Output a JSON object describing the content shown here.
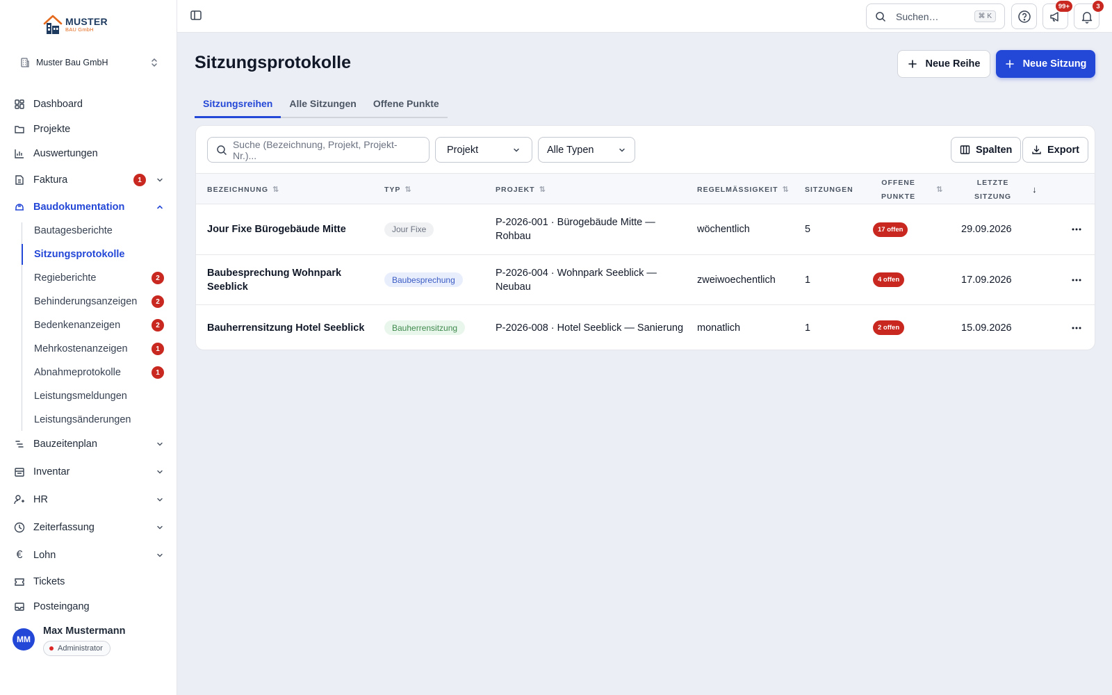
{
  "brand": {
    "title": "MUSTER",
    "subtitle": "BAU GmbH"
  },
  "org": {
    "name": "Muster Bau GmbH"
  },
  "nav": {
    "dashboard": "Dashboard",
    "projekte": "Projekte",
    "auswertungen": "Auswertungen",
    "faktura": {
      "label": "Faktura",
      "badge": "1"
    },
    "baudokumentation": "Baudokumentation",
    "sub": {
      "bautagesberichte": "Bautagesberichte",
      "sitzungsprotokolle": "Sitzungsprotokolle",
      "regieberichte": {
        "label": "Regieberichte",
        "badge": "2"
      },
      "behinderungsanzeigen": {
        "label": "Behinderungsanzeigen",
        "badge": "2"
      },
      "bedenkenanzeigen": {
        "label": "Bedenkenanzeigen",
        "badge": "2"
      },
      "mehrkostenanzeigen": {
        "label": "Mehrkostenanzeigen",
        "badge": "1"
      },
      "abnahmeprotokolle": {
        "label": "Abnahmeprotokolle",
        "badge": "1"
      },
      "leistungsmeldungen": "Leistungsmeldungen",
      "leistungsaenderungen": "Leistungsänderungen"
    },
    "bauzeitenplan": "Bauzeitenplan",
    "inventar": "Inventar",
    "hr": "HR",
    "zeiterfassung": "Zeiterfassung",
    "lohn": "Lohn",
    "tickets": "Tickets",
    "posteingang": "Posteingang"
  },
  "user": {
    "initials": "MM",
    "name": "Max Mustermann",
    "role": "Administrator"
  },
  "topbar": {
    "search_placeholder": "Suchen…",
    "shortcut": "⌘ K",
    "announcements_badge": "99+",
    "notifications_badge": "3"
  },
  "page": {
    "title": "Sitzungsprotokolle",
    "new_series": "Neue Reihe",
    "new_session": "Neue Sitzung"
  },
  "tabs": [
    "Sitzungsreihen",
    "Alle Sitzungen",
    "Offene Punkte"
  ],
  "filters": {
    "search_placeholder": "Suche (Bezeichnung, Projekt, Projekt-Nr.)...",
    "project": "Projekt",
    "type": "Alle Typen",
    "columns": "Spalten",
    "export": "Export"
  },
  "table": {
    "headers": {
      "bezeichnung": "BEZEICHNUNG",
      "typ": "TYP",
      "projekt": "PROJEKT",
      "regel": "REGELMÄSSIGKEIT",
      "sitzungen": "SITZUNGEN",
      "offene_1": "OFFENE",
      "offene_2": "PUNKTE",
      "letzte_1": "LETZTE",
      "letzte_2": "SITZUNG"
    },
    "rows": [
      {
        "name": "Jour Fixe Bürogebäude Mitte",
        "type": "Jour Fixe",
        "project_1": "P-2026-001 · Bürogebäude Mitte —",
        "project_2": "Rohbau",
        "regularity": "wöchentlich",
        "sessions": "5",
        "open": "17 offen",
        "last": "29.09.2026"
      },
      {
        "name_1": "Baubesprechung Wohnpark",
        "name_2": "Seeblick",
        "type": "Baubesprechung",
        "project_1": "P-2026-004 · Wohnpark Seeblick —",
        "project_2": "Neubau",
        "regularity": "zweiwoechentlich",
        "sessions": "1",
        "open": "4 offen",
        "last": "17.09.2026"
      },
      {
        "name": "Bauherrensitzung Hotel Seeblick",
        "type": "Bauherrensitzung",
        "project": "P-2026-008 · Hotel Seeblick — Sanierung",
        "regularity": "monatlich",
        "sessions": "1",
        "open": "2 offen",
        "last": "15.09.2026"
      }
    ]
  },
  "colors": {
    "accent": "#2347d6",
    "danger": "#c8281f",
    "pill_gray_bg": "#f0f1f3",
    "pill_blue_bg": "#e8eefc",
    "pill_green_bg": "#e9f6ec"
  }
}
